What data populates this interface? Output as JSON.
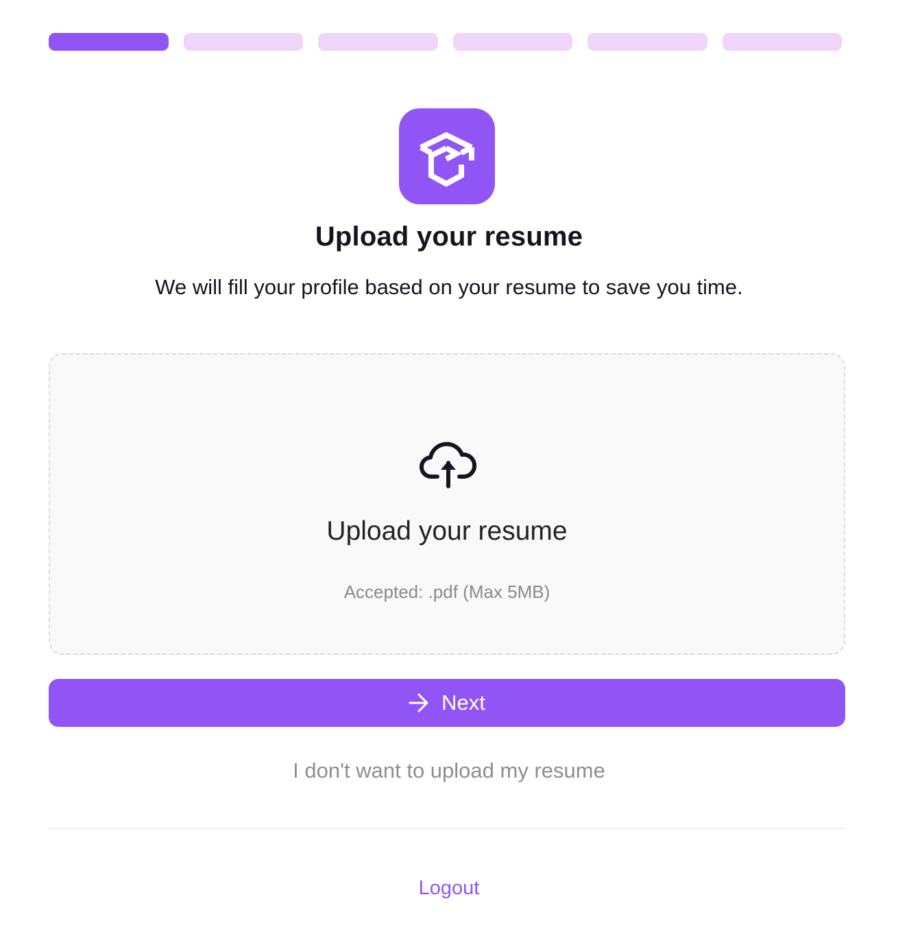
{
  "progress": {
    "total_steps": 6,
    "current_step": 1
  },
  "colors": {
    "accent": "#9155f6",
    "progress_inactive": "#efd6f8",
    "text_primary": "#15151f",
    "text_muted": "#8e8e8e",
    "dropzone_bg": "#f9f9f9"
  },
  "logo": {
    "icon": "graduation-cap-icon"
  },
  "header": {
    "title": "Upload your resume",
    "subtitle": "We will fill your profile based on your resume to save you time."
  },
  "dropzone": {
    "icon": "cloud-upload-icon",
    "title": "Upload your resume",
    "hint": "Accepted: .pdf (Max 5MB)"
  },
  "actions": {
    "next_label": "Next",
    "next_icon": "arrow-right-icon",
    "skip_label": "I don't want to upload my resume"
  },
  "footer": {
    "logout_label": "Logout"
  }
}
